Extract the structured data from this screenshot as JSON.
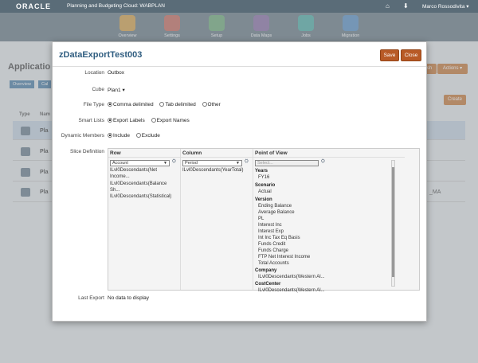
{
  "topbar": {
    "logo": "ORACLE",
    "app_title": "Planning and Budgeting Cloud: WABPLAN",
    "user": "Marco Rossodivita ▾"
  },
  "nav": {
    "items": [
      "Overview",
      "Settings",
      "Setup",
      "Data Maps",
      "Jobs",
      "Migration"
    ]
  },
  "background": {
    "page_title": "Applicatio",
    "tab1": "Overview",
    "tab2": "Cal",
    "actions_label": "Actions ▾",
    "sh_label": "sh",
    "create_label": "Create",
    "col_type": "Type",
    "col_name": "Nam",
    "rows": [
      "Pla",
      "Pla",
      "Pla",
      "Pla"
    ],
    "row_tail": "_MA"
  },
  "dialog": {
    "title": "zDataExportTest003",
    "save_label": "Save",
    "close_label": "Close",
    "location_label": "Location",
    "location_value": "Outbox",
    "cube_label": "Cube",
    "cube_value": "Plan1",
    "filetype_label": "File Type",
    "filetype_options": [
      "Comma delimited",
      "Tab delimited",
      "Other"
    ],
    "smartlists_label": "Smart Lists",
    "smartlists_options": [
      "Export Labels",
      "Export Names"
    ],
    "dynmembers_label": "Dynamic Members",
    "dynmembers_options": [
      "Include",
      "Exclude"
    ],
    "slice_label": "Slice Definition",
    "row_header": "Row",
    "column_header": "Column",
    "pov_header": "Point of View",
    "row_dimension": "Account",
    "row_items": [
      "ILvl0Descendants(Net",
      "Income...",
      "ILvl0Descendants(Balance",
      "Sh...",
      "ILvl0Descendants(Statistical)"
    ],
    "column_dimension": "Period",
    "column_items": [
      "ILvl0Descendants(YearTotal)"
    ],
    "pov_select": "Select...",
    "pov": [
      {
        "name": "Years",
        "members": [
          "FY16"
        ]
      },
      {
        "name": "Scenario",
        "members": [
          "Actual"
        ]
      },
      {
        "name": "Version",
        "members": [
          "Ending Balance",
          "Average Balance",
          "PL",
          "Interest Inc",
          "Interest Exp",
          "Int Inc Tax Eq Basis",
          "Funds Credit",
          "Funds Charge",
          "FTP Net Interest Income",
          "Total Accounts"
        ]
      },
      {
        "name": "Company",
        "members": [
          "ILvl0Descendants(Western Al..."
        ]
      },
      {
        "name": "CostCenter",
        "members": [
          "ILvl0Descendants(Western Al..."
        ]
      }
    ],
    "lastexport_label": "Last Export",
    "lastexport_value": "No data to display"
  },
  "colors": {
    "accent": "#b85a26",
    "title": "#2f5d80",
    "topbar": "#5a6c78"
  }
}
